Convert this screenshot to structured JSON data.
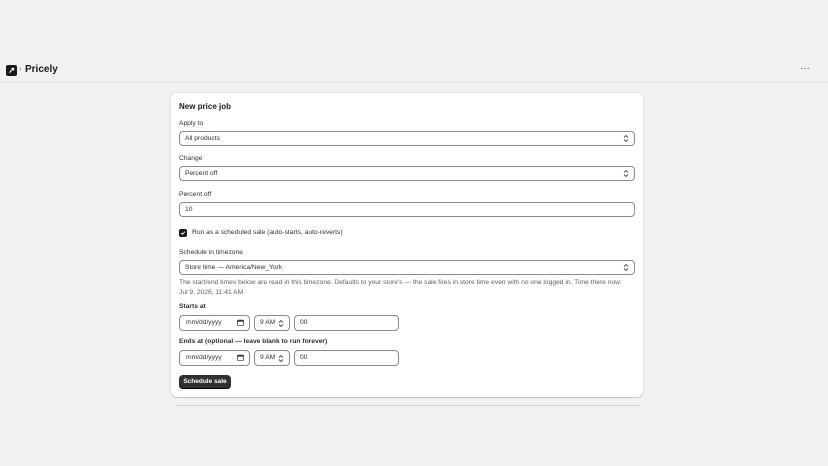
{
  "header": {
    "breadcrumb_sep": "›",
    "app_name": "Pricely",
    "more_glyph": "···",
    "app_icon": "pricely-logo-icon",
    "more_icon": "more-horizontal-icon"
  },
  "form": {
    "title": "New price job",
    "apply_to": {
      "label": "Apply to",
      "value": "All products"
    },
    "change": {
      "label": "Change",
      "value": "Percent off"
    },
    "percent_off": {
      "label": "Percent off",
      "value": "10"
    },
    "scheduled": {
      "label": "Run as a scheduled sale (auto-starts, auto-reverts)",
      "checked": true
    },
    "timezone": {
      "label": "Schedule in timezone",
      "value": "Store time — America/New_York",
      "help": "The start/end times below are read in this timezone. Defaults to your store's — the sale fires in store time even with no one logged in. Time there now: Jul 9, 2026, 11:41 AM"
    },
    "starts_at": {
      "label": "Starts at",
      "date_placeholder": "mm/dd/yyyy",
      "hour": "9 AM",
      "minute": "00"
    },
    "ends_at": {
      "label": "Ends at (optional — leave blank to run forever)",
      "date_placeholder": "mm/dd/yyyy",
      "hour": "9 AM",
      "minute": "00"
    },
    "submit_label": "Schedule sale"
  },
  "colors": {
    "page_bg": "#f1f1f1",
    "card_bg": "#ffffff",
    "primary_button": "#303030",
    "border": "#8a8a8a"
  }
}
